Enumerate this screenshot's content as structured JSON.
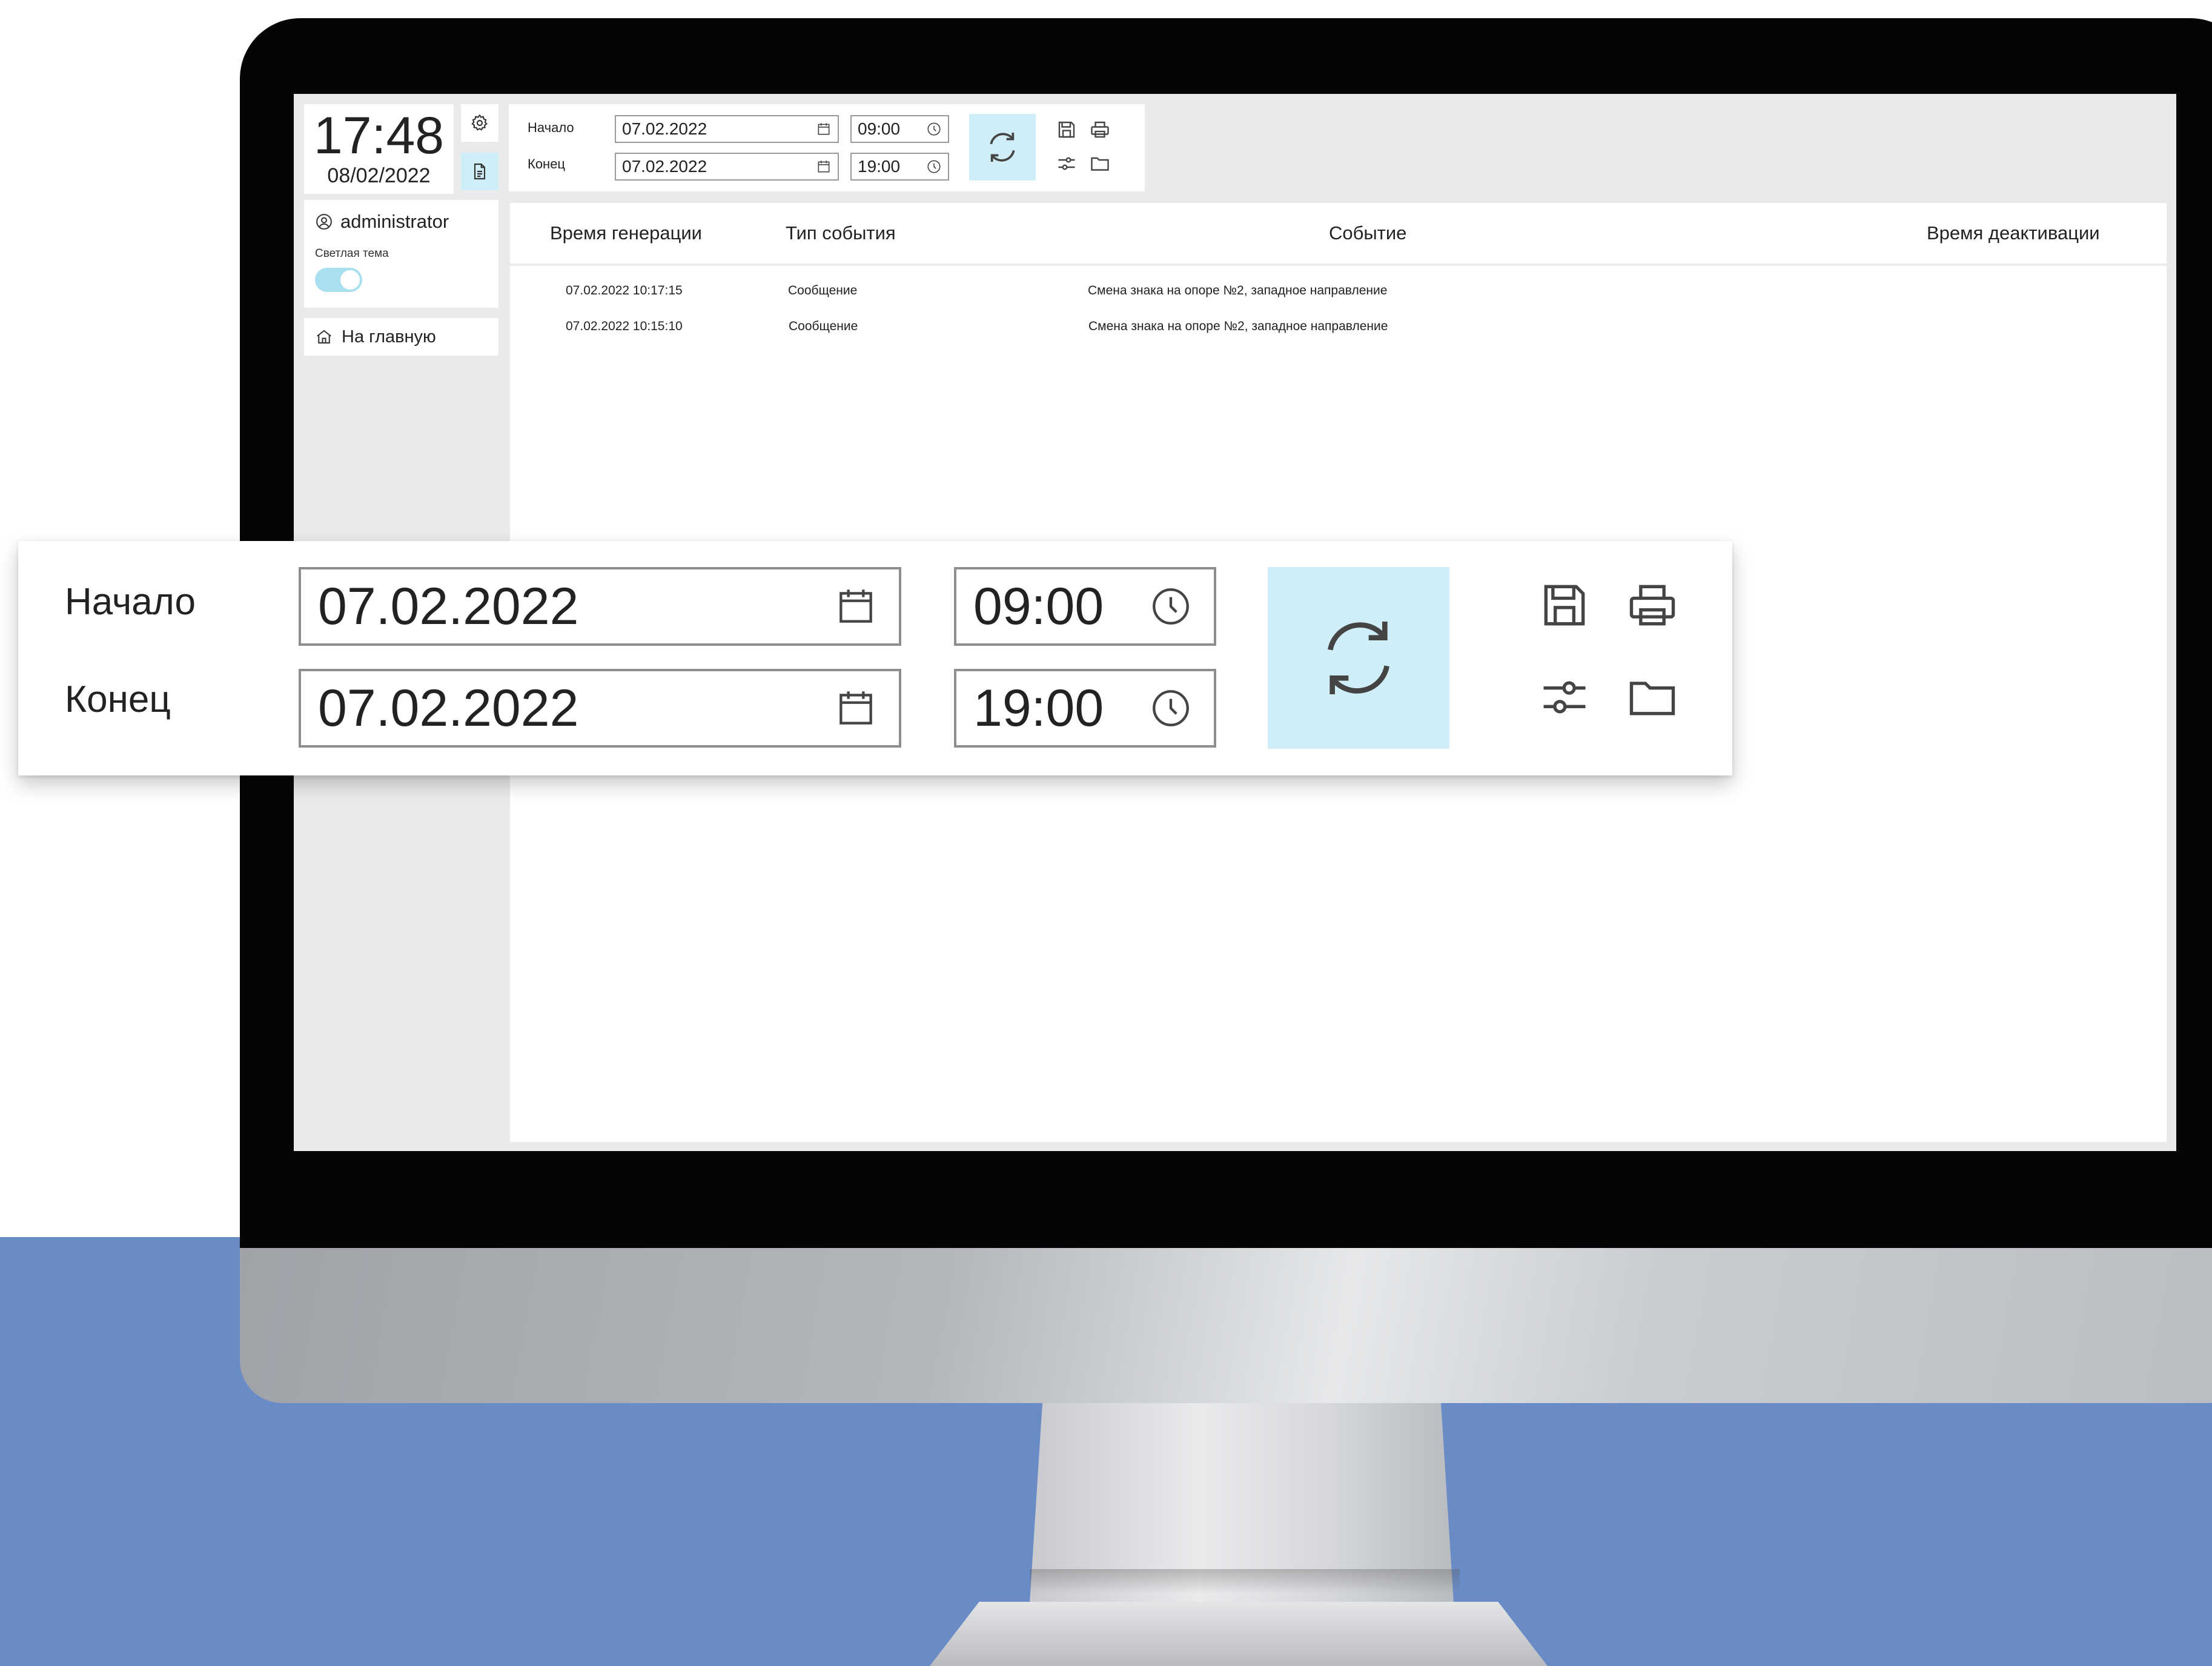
{
  "clock": {
    "time": "17:48",
    "date": "08/02/2022"
  },
  "sidebar": {
    "settings_icon": "gear-icon",
    "report_icon": "document-icon",
    "user": {
      "name": "administrator",
      "icon": "user-circle-icon"
    },
    "theme_label": "Светлая тема",
    "theme_toggle_on": true,
    "home": {
      "label": "На главную",
      "icon": "home-icon"
    }
  },
  "filter": {
    "start_label": "Начало",
    "end_label": "Конец",
    "start_date": "07.02.2022",
    "end_date": "07.02.2022",
    "start_time": "09:00",
    "end_time": "19:00",
    "icons": [
      "calendar-icon",
      "clock-icon",
      "refresh-icon",
      "save-icon",
      "print-icon",
      "sliders-icon",
      "folder-icon"
    ]
  },
  "table": {
    "columns": [
      "Время генерации",
      "Тип события",
      "Событие",
      "Время деактивации"
    ],
    "rows": [
      {
        "time": "07.02.2022 10:17:15",
        "type": "Сообщение",
        "event": "Смена знака на опоре №2, западное направление",
        "deactivated": ""
      },
      {
        "time": "07.02.2022 10:15:10",
        "type": "Сообщение",
        "event": "Смена знака на опоре №2, западное направление",
        "deactivated": ""
      }
    ]
  },
  "colors": {
    "accent": "#cfeef7",
    "toggle": "#a9dfee",
    "background_blue": "#6a8cc6",
    "screen_bg": "#e9eaeb"
  }
}
